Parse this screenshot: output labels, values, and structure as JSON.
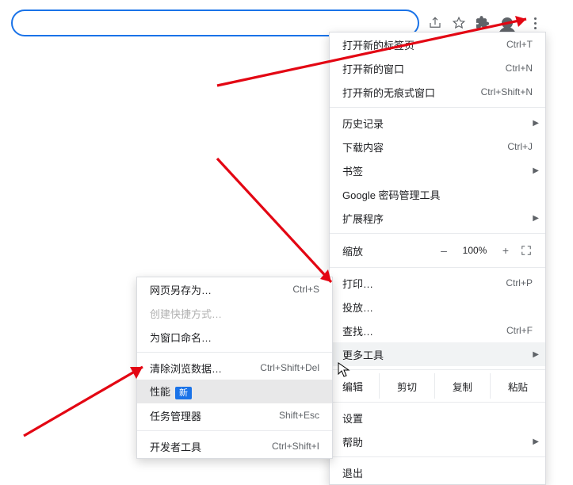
{
  "toolbar": {
    "share_name": "share-icon",
    "star_name": "bookmark-star-icon",
    "ext_name": "extensions-icon",
    "profile_name": "profile-avatar",
    "kebab_name": "chrome-menu-button"
  },
  "menu": {
    "new_tab": {
      "label": "打开新的标签页",
      "shortcut": "Ctrl+T"
    },
    "new_window": {
      "label": "打开新的窗口",
      "shortcut": "Ctrl+N"
    },
    "new_incognito": {
      "label": "打开新的无痕式窗口",
      "shortcut": "Ctrl+Shift+N"
    },
    "history": {
      "label": "历史记录"
    },
    "downloads": {
      "label": "下载内容",
      "shortcut": "Ctrl+J"
    },
    "bookmarks": {
      "label": "书签"
    },
    "passwords": {
      "label": "Google 密码管理工具"
    },
    "extensions": {
      "label": "扩展程序"
    },
    "zoom": {
      "label": "缩放",
      "minus": "–",
      "value": "100%",
      "plus": "+"
    },
    "print": {
      "label": "打印…",
      "shortcut": "Ctrl+P"
    },
    "cast": {
      "label": "投放…"
    },
    "find": {
      "label": "查找…",
      "shortcut": "Ctrl+F"
    },
    "more_tools": {
      "label": "更多工具"
    },
    "edit": {
      "label": "编辑",
      "cut": "剪切",
      "copy": "复制",
      "paste": "粘贴"
    },
    "settings": {
      "label": "设置"
    },
    "help": {
      "label": "帮助"
    },
    "exit": {
      "label": "退出"
    }
  },
  "submenu": {
    "save_as": {
      "label": "网页另存为…",
      "shortcut": "Ctrl+S"
    },
    "create_sc": {
      "label": "创建快捷方式…"
    },
    "name_window": {
      "label": "为窗口命名…"
    },
    "clear_data": {
      "label": "清除浏览数据…",
      "shortcut": "Ctrl+Shift+Del"
    },
    "performance": {
      "label": "性能",
      "badge": "新"
    },
    "task_mgr": {
      "label": "任务管理器",
      "shortcut": "Shift+Esc"
    },
    "dev_tools": {
      "label": "开发者工具",
      "shortcut": "Ctrl+Shift+I"
    }
  }
}
